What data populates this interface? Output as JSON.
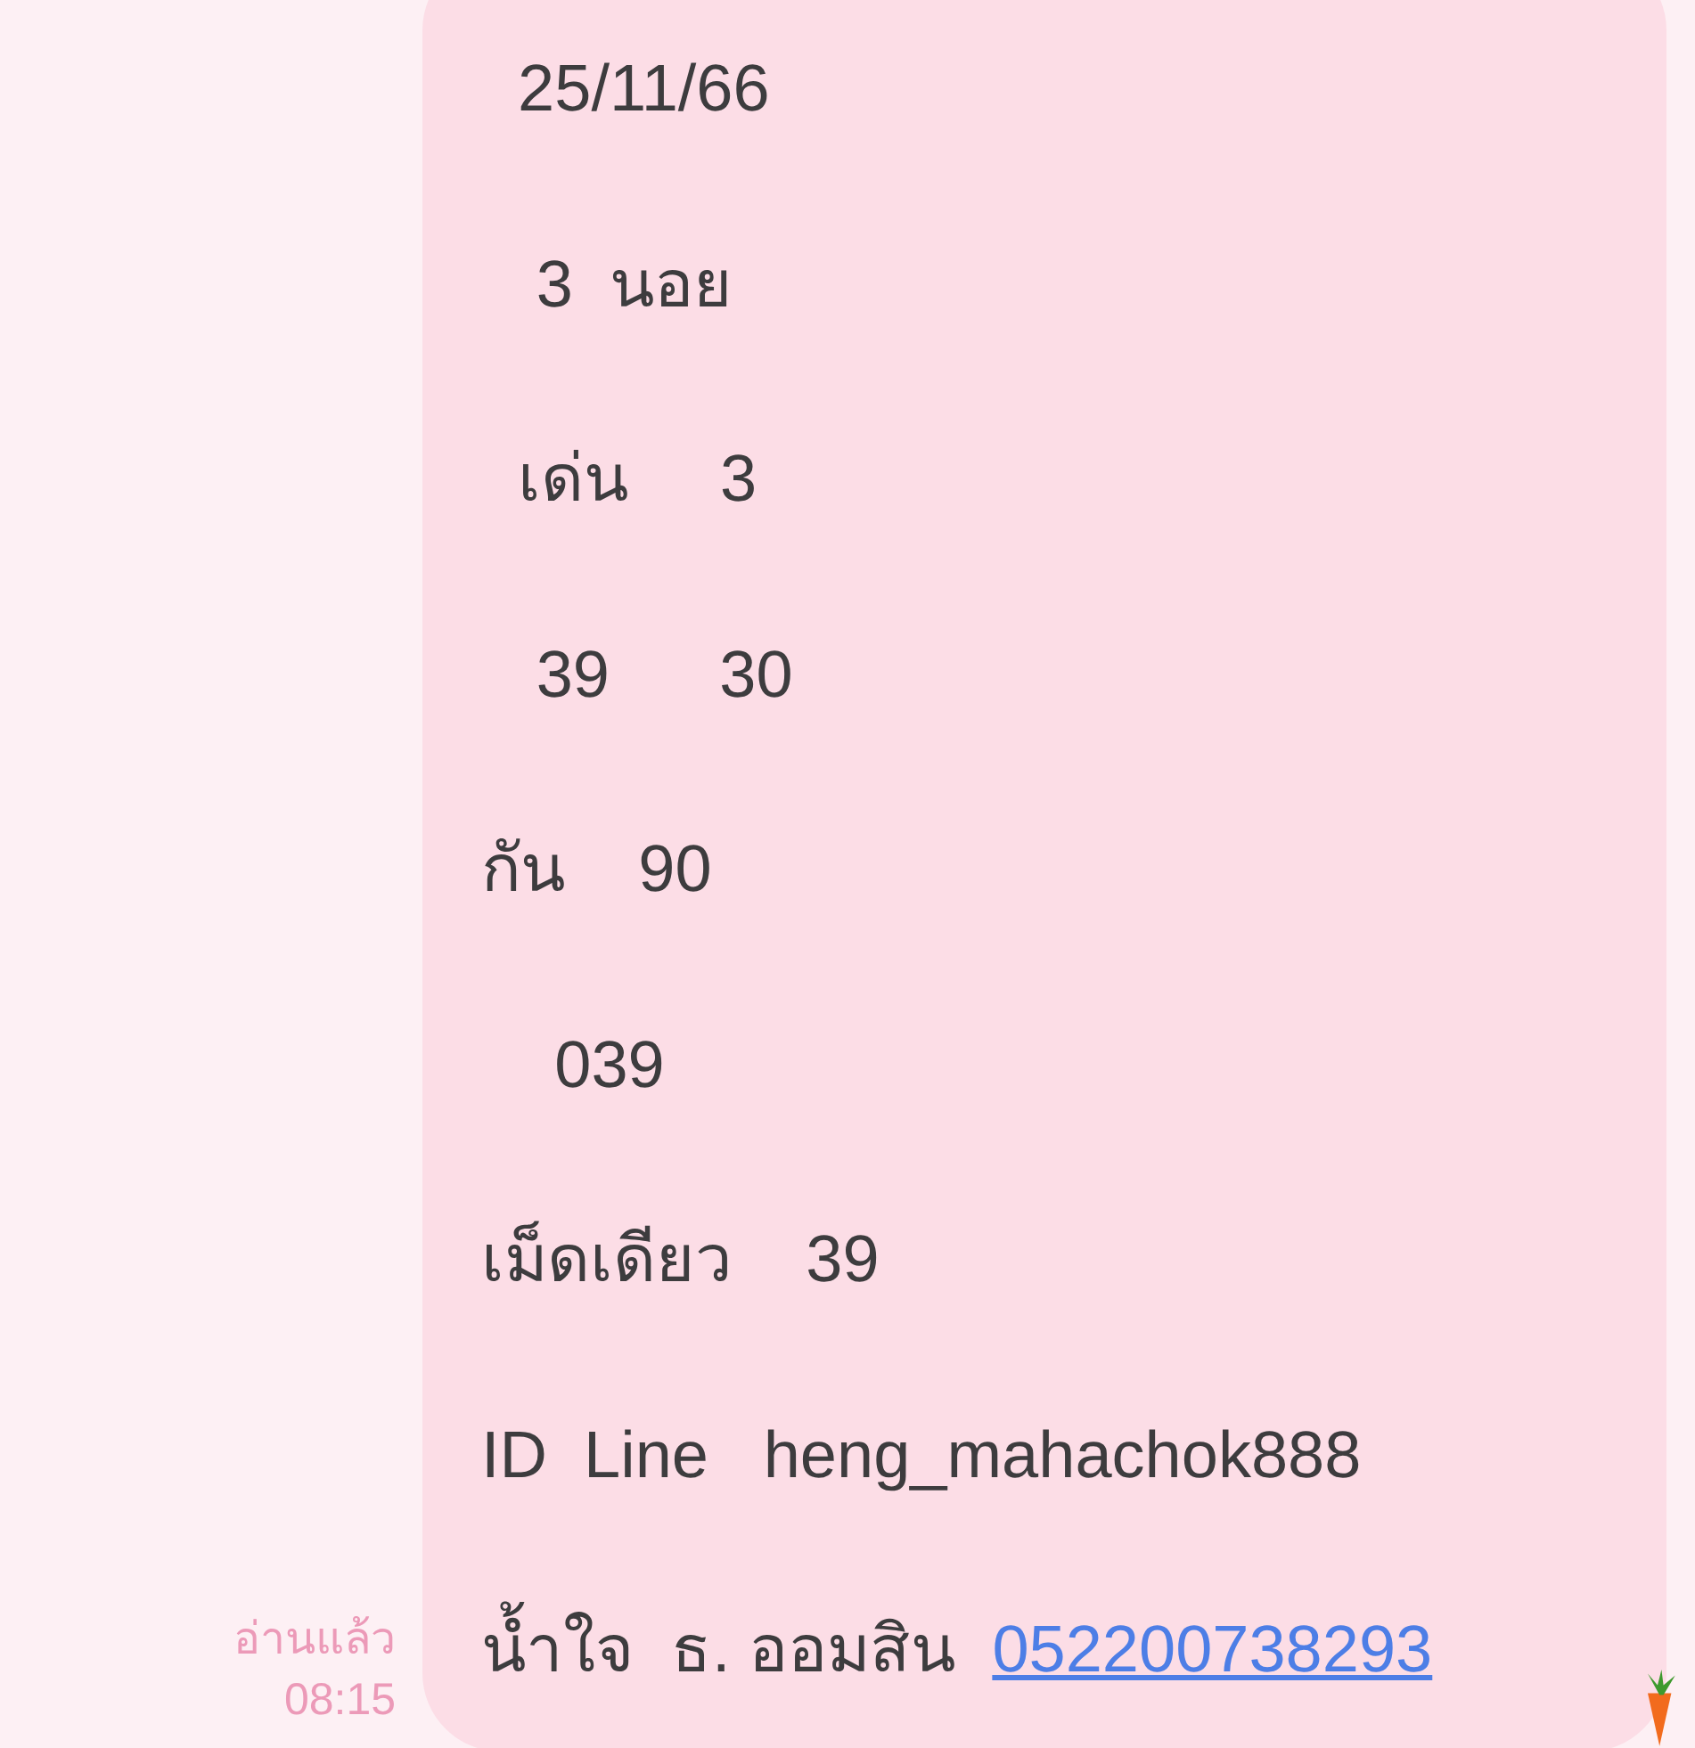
{
  "message": {
    "lines": [
      "  25/11/66",
      "   3  นอย",
      "  เด่น     3",
      "   39      30",
      "กัน    90",
      "    039",
      "เม็ดเดียว    39",
      "ID  Line   heng_mahachok888"
    ],
    "last_line": {
      "text": "น้ำใจ  ธ. ออมสิน  ",
      "link": "052200738293"
    },
    "read_status": "อ่านแล้ว",
    "time": "08:15"
  }
}
